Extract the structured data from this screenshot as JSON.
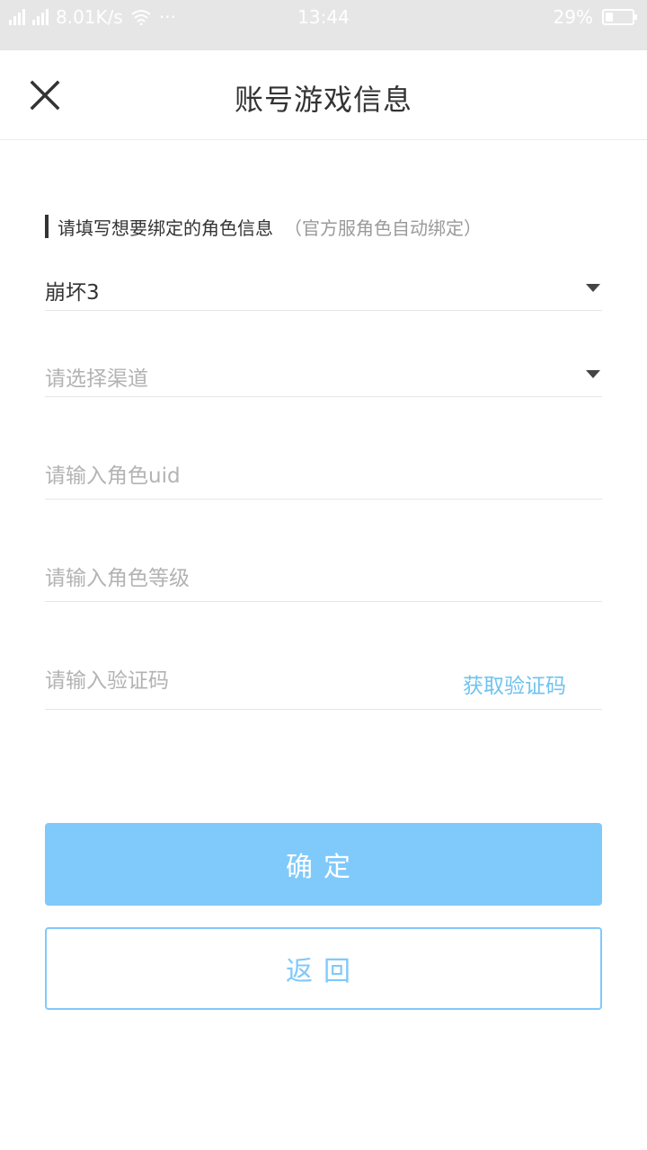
{
  "status_bar": {
    "net_speed": "8.01K/s",
    "dots": "···",
    "time": "13:44",
    "battery_percent": "29%",
    "battery_level": 0.29,
    "icons": [
      "signal-icon",
      "wifi-icon",
      "battery-icon"
    ]
  },
  "header": {
    "title": "账号游戏信息",
    "close_icon": "close-icon"
  },
  "section": {
    "label": "请填写想要绑定的角色信息",
    "hint": "（官方服角色自动绑定）"
  },
  "form": {
    "game": {
      "value": "崩坏3",
      "icon": "dropdown-arrow-icon"
    },
    "channel": {
      "placeholder": "请选择渠道",
      "icon": "dropdown-arrow-icon"
    },
    "uid": {
      "value": "",
      "placeholder": "请输入角色uid"
    },
    "level": {
      "value": "",
      "placeholder": "请输入角色等级"
    },
    "code": {
      "value": "",
      "placeholder": "请输入验证码",
      "get_code_label": "获取验证码"
    }
  },
  "buttons": {
    "confirm": "确定",
    "back": "返回"
  },
  "colors": {
    "accent": "#80c9fb",
    "link": "#6fc3f0",
    "status_bar_bg": "#e6e6e6"
  }
}
